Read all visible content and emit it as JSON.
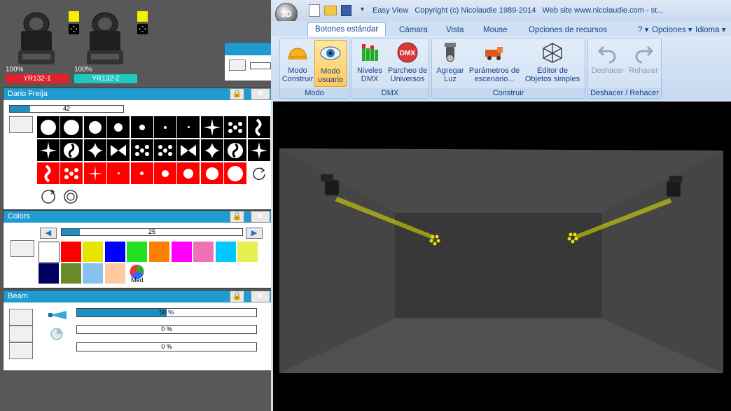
{
  "fixtures": [
    {
      "name": "YR132-1",
      "intensity": "100%",
      "color": "#e0222b",
      "swatch": "#f5f000"
    },
    {
      "name": "YR132-2",
      "intensity": "100%",
      "color": "#1ec8c0",
      "swatch": "#f5f000"
    }
  ],
  "gobo_panel": {
    "title": "Dario Freija",
    "slider_value": "42",
    "slider_fill": 0.18
  },
  "colors_panel": {
    "title": "Colors",
    "slider_value": "25",
    "slider_fill": 0.1,
    "swatches": [
      "#ffffff",
      "#ff0000",
      "#e6e600",
      "#0000ff",
      "#22e022",
      "#ff8000",
      "#ff00ff",
      "#f070b8",
      "#00c8ff",
      "#e6f050",
      "#000060",
      "#6a8a28",
      "#88c0f0",
      "#ffc8a0"
    ],
    "med_label": "Med"
  },
  "beam_panel": {
    "title": "Beam",
    "rows": [
      {
        "value": "50 %",
        "fill": 0.5
      },
      {
        "value": "0 %",
        "fill": 0
      },
      {
        "value": "0 %",
        "fill": 0
      }
    ]
  },
  "window": {
    "app_badge": "3D",
    "title": "Easy View   Copyright (c) Nicolaudie 1989-2014   Web site www.nicolaudie.com - st..."
  },
  "tabs": [
    "Botones estándar",
    "Cámara",
    "Vista",
    "Mouse",
    "Opciones de recursos"
  ],
  "tab_right": {
    "help": "?",
    "options": "Opciones",
    "language": "Idioma"
  },
  "ribbon": {
    "groups": [
      {
        "label": "Modo",
        "buttons": [
          "Modo\nConstruir",
          "Modo\nusuario"
        ]
      },
      {
        "label": "DMX",
        "buttons": [
          "Niveles\nDMX",
          "Parcheo de\nUniversos"
        ]
      },
      {
        "label": "Construir",
        "buttons": [
          "Agregar\nLuz",
          "Parámetros de\nescenario...",
          "Editor de\nObjetos simples"
        ]
      },
      {
        "label": "Deshacer / Rehacer",
        "buttons": [
          "Deshacer",
          "Rehacer"
        ]
      }
    ]
  },
  "colors": {
    "accent": "#1f9bd0",
    "ribbon_text": "#15428b",
    "beam_yellow": "#e6e600"
  }
}
